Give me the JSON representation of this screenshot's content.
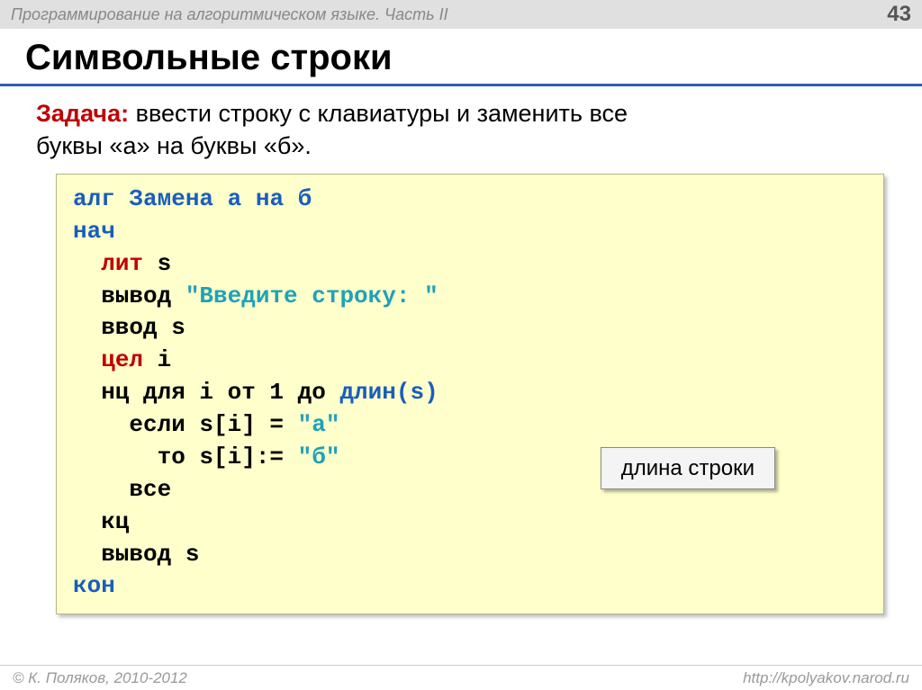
{
  "header": {
    "breadcrumb": "Программирование на алгоритмическом языке. Часть II",
    "page_number": "43"
  },
  "title": "Символьные строки",
  "task": {
    "label": "Задача:",
    "text_line1": " ввести строку с клавиатуры и заменить все",
    "text_line2": "буквы «а» на буквы «б»."
  },
  "code": {
    "l1_alg": "алг",
    "l1_name": " Замена а на б",
    "l2": "нач",
    "l3_kw": "лит",
    "l3_rest": " s",
    "l4_pre": "  вывод ",
    "l4_str": "\"Введите строку: \"",
    "l5": "  ввод s",
    "l6_kw": "цел",
    "l6_rest": " i",
    "l7_pre": "  нц для i от 1 до ",
    "l7_fn": "длин(s)",
    "l8_pre": "    если s[i] = ",
    "l8_str": "\"а\"",
    "l9_pre": "      то s[i]:= ",
    "l9_str": "\"б\"",
    "l10": "    все",
    "l11": "  кц",
    "l12": "  вывод s",
    "l13": "кон"
  },
  "callout": "длина строки",
  "footer": {
    "copyright": "© К. Поляков, 2010-2012",
    "url": "http://kpolyakov.narod.ru"
  }
}
